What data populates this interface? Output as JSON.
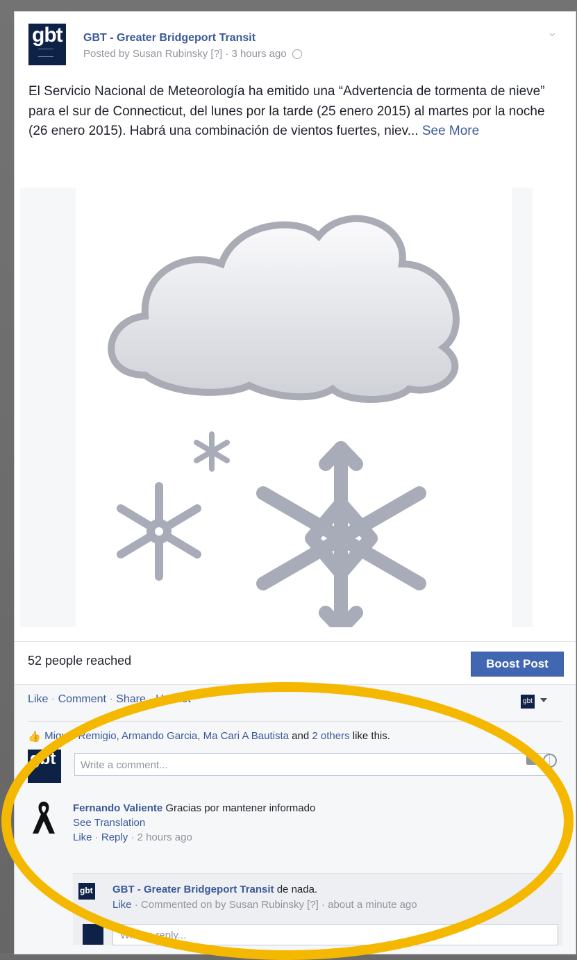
{
  "post": {
    "page_name": "GBT - Greater Bridgeport Transit",
    "logo_text": "gbt",
    "byline_prefix": "Posted by Susan Rubinsky [?] · 3 hours ago",
    "text": "El Servicio Nacional de Meteorología ha emitido una “Advertencia de tormenta de nieve” para el sur de Connecticut, del lunes por la tarde (25 enero 2015) al martes por la noche (26 enero 2015). Habrá una combinación de vientos fuertes, niev...",
    "see_more": "See More"
  },
  "stats": {
    "reach": "52 people reached",
    "boost_label": "Boost Post"
  },
  "actions": {
    "like": "Like",
    "comment": "Comment",
    "share": "Share",
    "hootlet": "Hootlet"
  },
  "likes": {
    "names": "Miguel Remigio, Armando Garcia, Ma Cari A Bautista",
    "and_text": " and ",
    "others": "2 others",
    "suffix": " like this."
  },
  "comment_input": {
    "placeholder": "Write a comment..."
  },
  "comment": {
    "author": "Fernando Valiente",
    "text": " Gracias por mantener informado",
    "see_translation": "See Translation",
    "like": "Like",
    "reply": "Reply",
    "time": "2 hours ago"
  },
  "reply": {
    "author": "GBT - Greater Bridgeport Transit",
    "text": " de nada.",
    "like": "Like",
    "meta": "Commented on by Susan Rubinsky [?] · about a minute ago",
    "placeholder": "Write a reply..."
  },
  "icons": {
    "globe": "globe-icon",
    "thumb": "thumbs-up-icon",
    "camera": "camera-icon",
    "smile": "smile-icon"
  },
  "colors": {
    "brand_blue": "#3b5998",
    "boost_blue": "#4267b2",
    "highlight": "#f5b800"
  }
}
